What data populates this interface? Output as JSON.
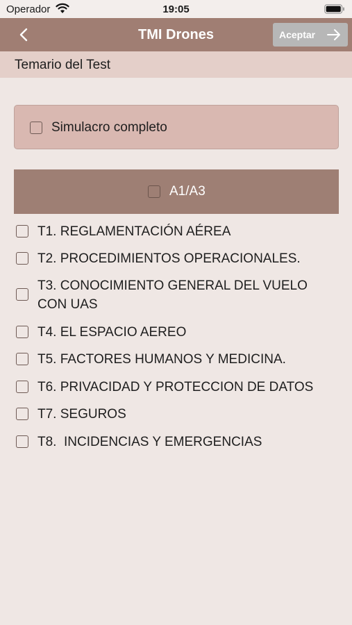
{
  "status_bar": {
    "carrier": "Operador",
    "time": "19:05"
  },
  "navbar": {
    "title": "TMI Drones",
    "accept_label": "Aceptar"
  },
  "subheader": {
    "title": "Temario del Test"
  },
  "simulacro": {
    "label": "Simulacro completo",
    "checked": false
  },
  "section": {
    "label": "A1/A3",
    "checked": false
  },
  "topics": [
    {
      "label": "T1. REGLAMENTACIÓN AÉREA",
      "checked": false
    },
    {
      "label": "T2. PROCEDIMIENTOS OPERACIONALES.",
      "checked": false
    },
    {
      "label": "T3. CONOCIMIENTO GENERAL DEL VUELO CON UAS",
      "checked": false
    },
    {
      "label": "T4. EL ESPACIO AEREO",
      "checked": false
    },
    {
      "label": "T5. FACTORES HUMANOS Y MEDICINA.",
      "checked": false
    },
    {
      "label": "T6. PRIVACIDAD Y PROTECCION DE DATOS",
      "checked": false
    },
    {
      "label": "T7. SEGUROS",
      "checked": false
    },
    {
      "label": "T8.  INCIDENCIAS Y EMERGENCIAS",
      "checked": false
    }
  ],
  "colors": {
    "nav_background": "#a07e73",
    "subheader_background": "#e4cfc9",
    "card_background": "#d9b8b1",
    "section_background": "#9e7f74",
    "page_background": "#efe7e4",
    "accept_background": "#b7b7b7"
  },
  "icons": [
    "wifi-icon",
    "battery-icon",
    "back-chevron-icon",
    "arrow-right-icon",
    "checkbox-icon"
  ]
}
